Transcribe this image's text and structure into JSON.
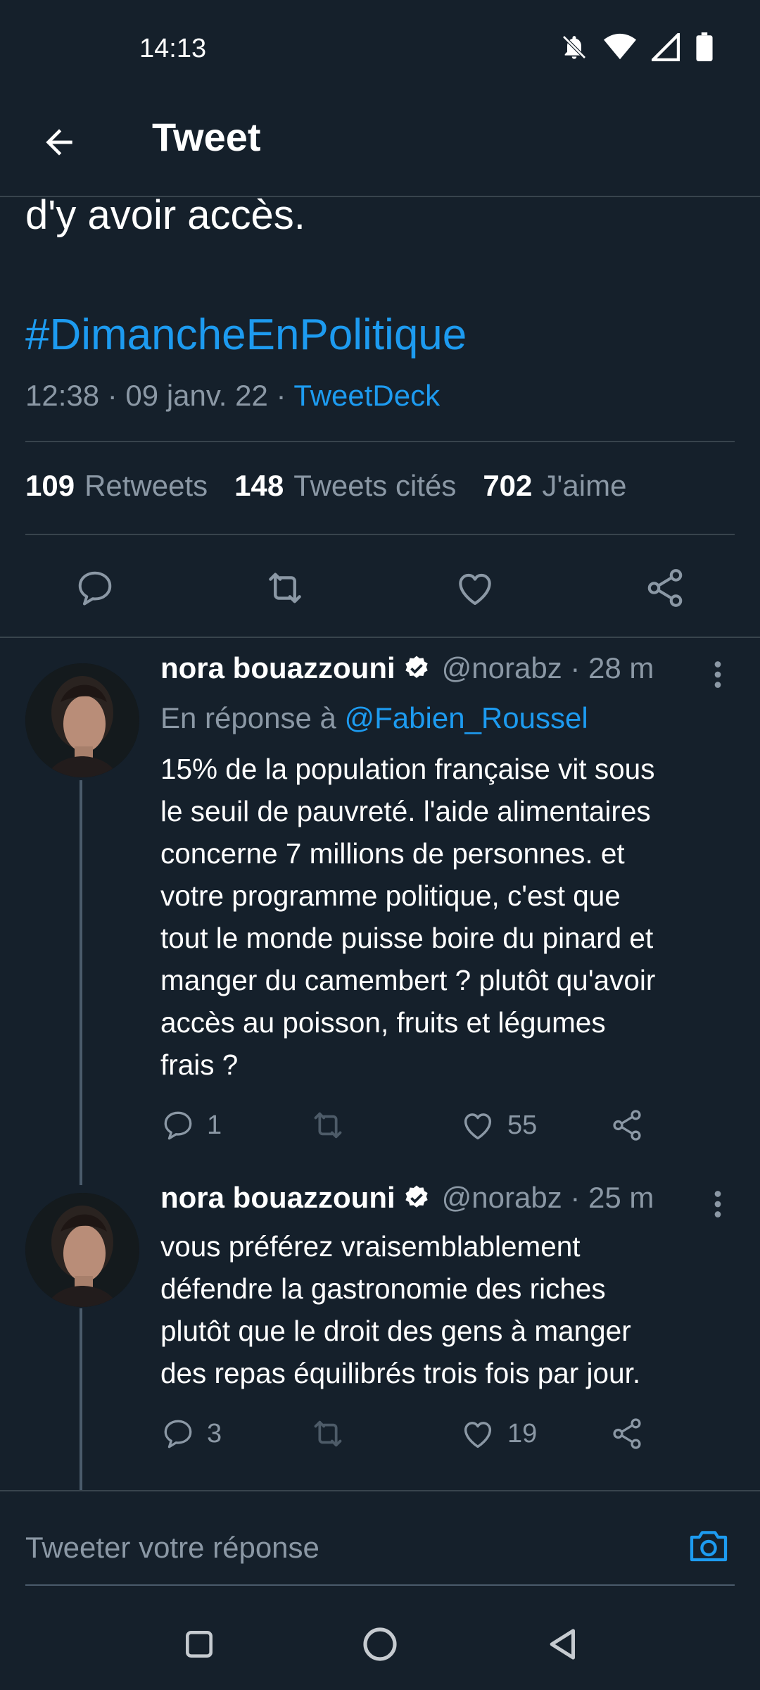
{
  "status_bar": {
    "time": "14:13"
  },
  "header": {
    "title": "Tweet"
  },
  "main_tweet": {
    "text_tail": "d'y avoir accès.",
    "hashtag": "#DimancheEnPolitique",
    "time": "12:38 · 09 janv. 22 · ",
    "source": "TweetDeck",
    "stats": {
      "retweets_count": "109",
      "retweets_label": "Retweets",
      "quotes_count": "148",
      "quotes_label": "Tweets cités",
      "likes_count": "702",
      "likes_label": "J'aime"
    }
  },
  "replies": [
    {
      "name": "nora bouazzouni",
      "handle": "@norabz · 28 m",
      "reply_to_prefix": "En réponse à ",
      "reply_to_mention": "@Fabien_Roussel",
      "lines": [
        "15% de la population française vit sous",
        "le seuil de pauvreté. l'aide alimentaires",
        "concerne 7 millions de personnes. et",
        "votre programme politique, c'est que",
        "tout le monde puisse boire du pinard et",
        "manger du camembert ? plutôt qu'avoir",
        "accès au poisson, fruits et légumes",
        "frais ?"
      ],
      "reply_count": "1",
      "retweet_count": "",
      "like_count": "55"
    },
    {
      "name": "nora bouazzouni",
      "handle": "@norabz · 25 m",
      "lines": [
        "vous préférez vraisemblablement",
        "défendre la gastronomie des riches",
        "plutôt que le droit des gens à manger",
        "des repas équilibrés trois fois par jour."
      ],
      "reply_count": "3",
      "retweet_count": "",
      "like_count": "19"
    }
  ],
  "reply_input": {
    "placeholder": "Tweeter votre réponse"
  },
  "colors": {
    "background": "#15202b",
    "accent": "#1d9bf0",
    "muted": "#8b98a5",
    "divider": "#38444d"
  },
  "icons": [
    "back-arrow-icon",
    "reply-icon",
    "retweet-icon",
    "like-icon",
    "share-icon",
    "verified-badge-icon",
    "more-icon",
    "camera-icon",
    "recents-icon",
    "home-icon",
    "back-nav-icon"
  ]
}
